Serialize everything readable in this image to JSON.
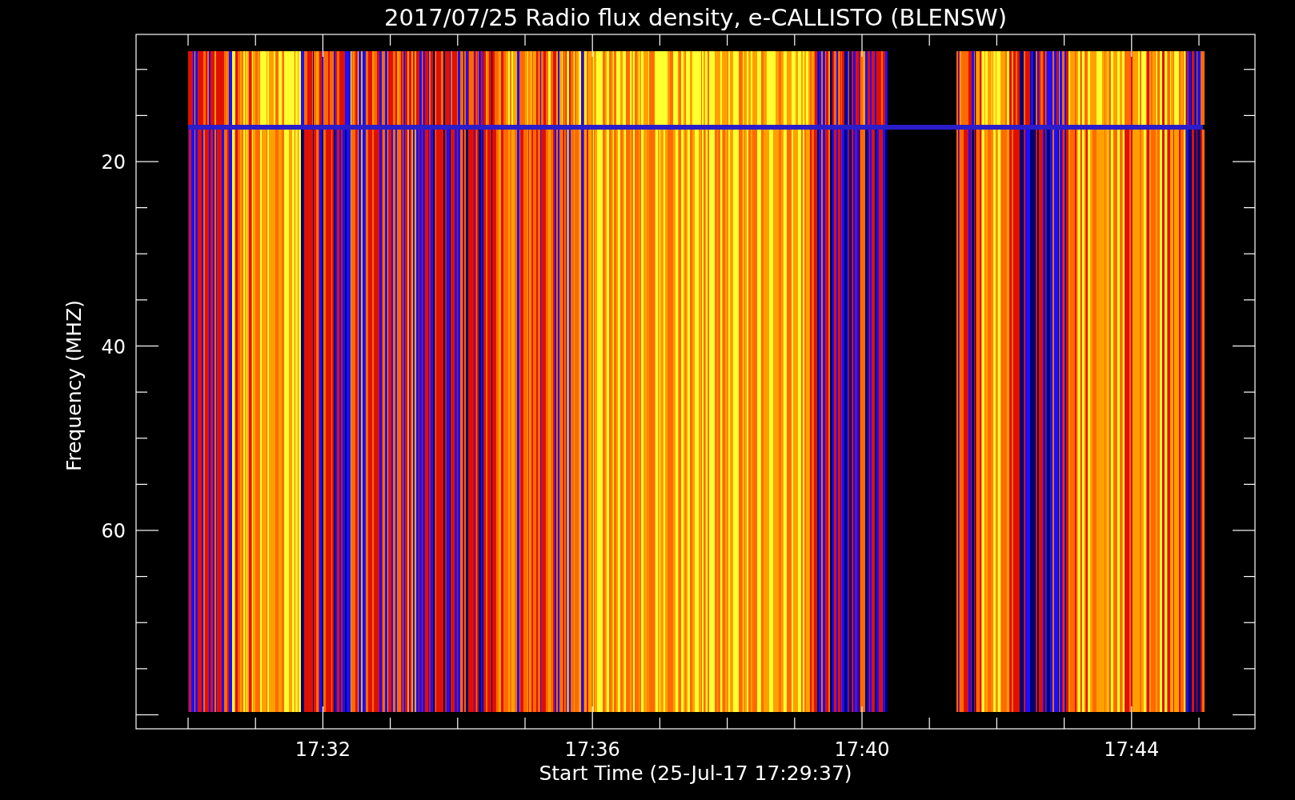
{
  "title": "2017/07/25  Radio flux density, e-CALLISTO (BLENSW)",
  "ylabel": "Frequency (MHZ)",
  "xlabel": "Start Time (25-Jul-17 17:29:37)",
  "yticks": [
    "20",
    "40",
    "60"
  ],
  "xticks": [
    "17:32",
    "17:36",
    "17:40",
    "17:44"
  ]
}
